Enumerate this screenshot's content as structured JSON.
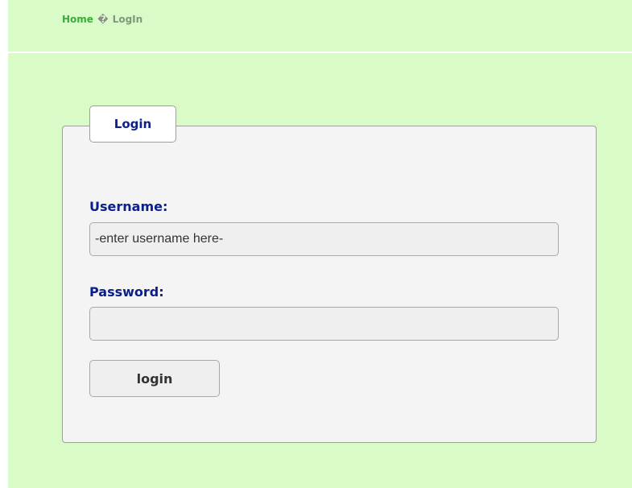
{
  "breadcrumb": {
    "home": "Home",
    "separator": "�",
    "current": "LogIn"
  },
  "form": {
    "legend": "Login",
    "username_label": "Username:",
    "username_value": "",
    "username_placeholder": "-enter username here-",
    "password_label": "Password:",
    "password_value": "",
    "submit_label": "login"
  },
  "colors": {
    "page_background": "#d9fbc8",
    "panel_background": "#f4f4f4",
    "label_color": "#0a1e8c",
    "breadcrumb_link": "#3bab3a",
    "breadcrumb_current": "#7a9a7a"
  }
}
